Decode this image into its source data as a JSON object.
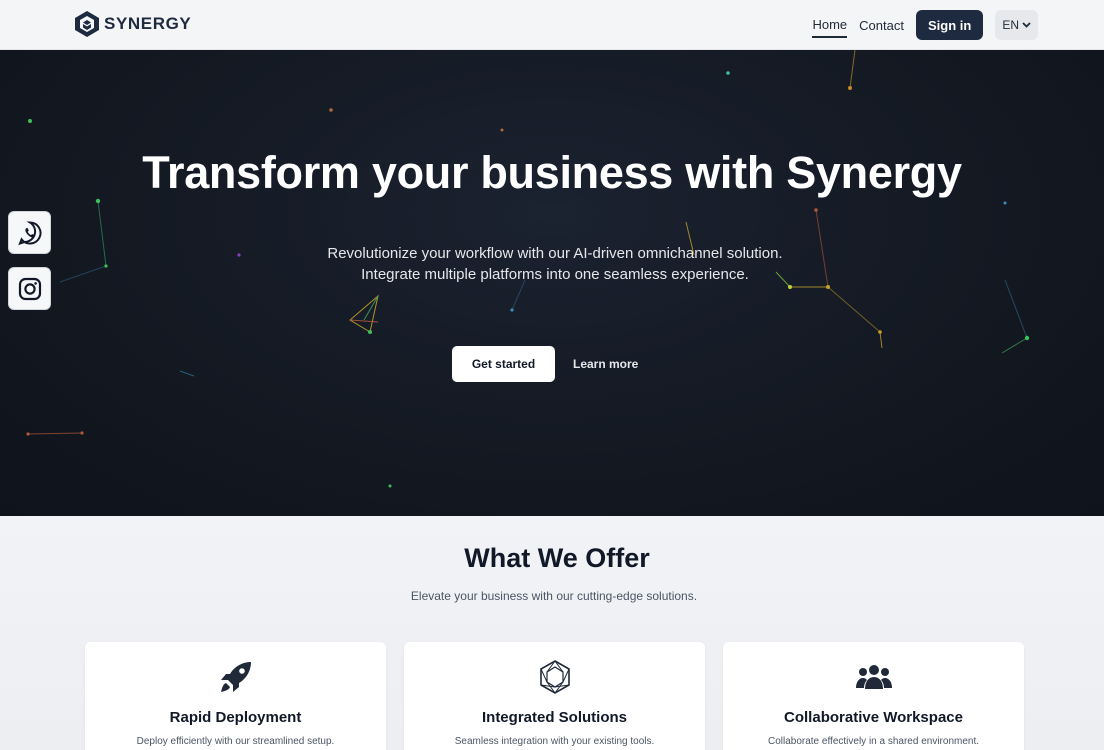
{
  "brand": {
    "name": "SYNERGY",
    "color": "#1e2a3f"
  },
  "header": {
    "nav": {
      "home": "Home",
      "contact": "Contact"
    },
    "signin_label": "Sign in",
    "language": "EN"
  },
  "hero": {
    "title": "Transform your business with Synergy",
    "subtitle_line1": "Revolutionize your workflow with our AI-driven omnichannel solution.",
    "subtitle_line2": "Integrate multiple platforms into one seamless experience.",
    "primary_cta": "Get started",
    "secondary_cta": "Learn more",
    "background_color": "#131821"
  },
  "social": [
    {
      "icon": "whatsapp-icon"
    },
    {
      "icon": "instagram-icon"
    }
  ],
  "offer": {
    "title": "What We Offer",
    "subtitle": "Elevate your business with our cutting-edge solutions.",
    "cards": [
      {
        "icon": "rocket-icon",
        "title": "Rapid Deployment",
        "description": "Deploy efficiently with our streamlined setup."
      },
      {
        "icon": "hexagon-network-icon",
        "title": "Integrated Solutions",
        "description": "Seamless integration with your existing tools."
      },
      {
        "icon": "team-icon",
        "title": "Collaborative Workspace",
        "description": "Collaborate effectively in a shared environment."
      }
    ]
  }
}
